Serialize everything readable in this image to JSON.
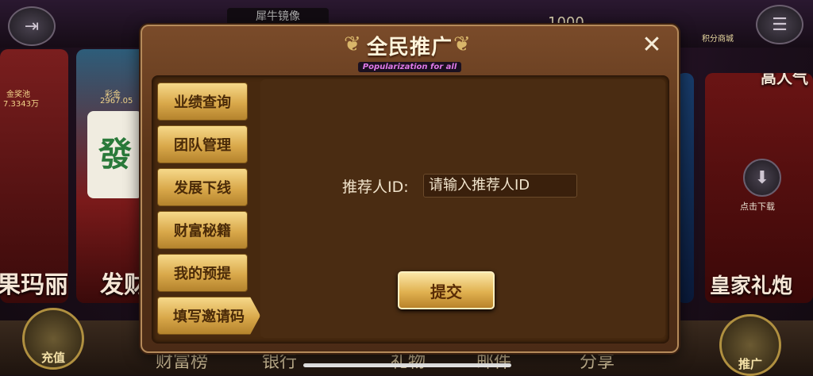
{
  "lobby": {
    "player_name": "犀牛镜像",
    "coins": "1000",
    "shop_label": "积分商城",
    "cards": {
      "left_title": "果玛丽",
      "left_jackpot_label": "金奖池",
      "left_jackpot_value": "7.3343万",
      "left2_title": "发财",
      "left2_jackpot_label": "彩金",
      "left2_jackpot_value": "2967.05",
      "right_title": "皇家礼炮",
      "right_top_title": "高人气",
      "right_download": "点击下载"
    },
    "bottom": {
      "recharge": "充值",
      "wealth_rank": "财富榜",
      "bank": "银行",
      "gift": "礼物",
      "mail": "邮件",
      "share": "分享",
      "promote": "推广"
    }
  },
  "modal": {
    "title": "全民推广",
    "subtitle": "Popularization for all",
    "close_symbol": "✕",
    "menu": [
      {
        "label": "业绩查询"
      },
      {
        "label": "团队管理"
      },
      {
        "label": "发展下线"
      },
      {
        "label": "财富秘籍"
      },
      {
        "label": "我的预提"
      },
      {
        "label": "填写邀请码"
      }
    ],
    "active_menu": "填写邀请码",
    "form": {
      "label": "推荐人ID:",
      "placeholder": "请输入推荐人ID",
      "value": ""
    },
    "submit_label": "提交"
  },
  "colors": {
    "modal_bg": "#5a3418",
    "button_gold": "#d9a84a",
    "title_text": "#fff5dc"
  }
}
